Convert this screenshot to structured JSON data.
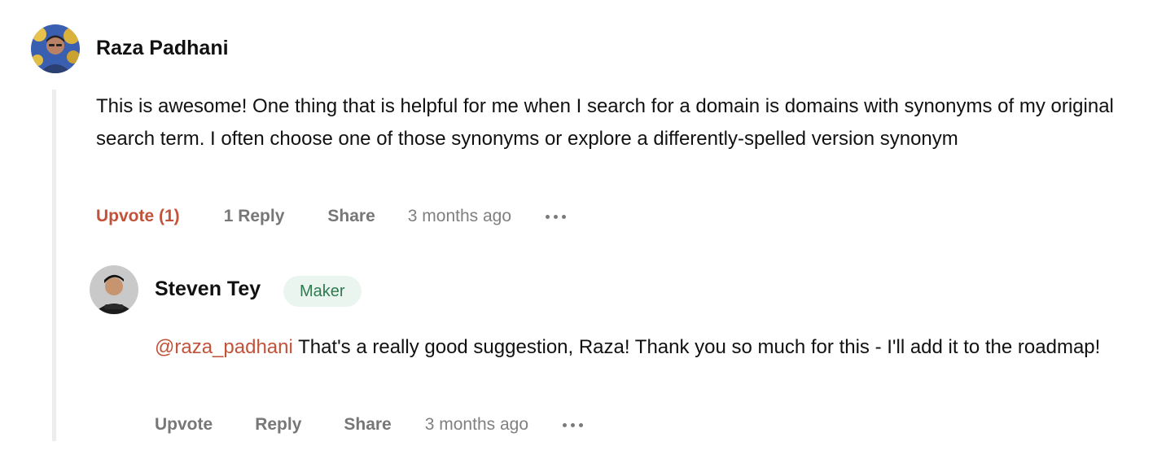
{
  "comment": {
    "author": "Raza Padhani",
    "body": "This is awesome! One thing that is helpful for me when I search for a domain is domains with synonyms of my original search term. I often choose one of those synonyms or explore a differently-spelled version synonym",
    "actions": {
      "upvote": "Upvote (1)",
      "reply": "1 Reply",
      "share": "Share",
      "time": "3 months ago"
    },
    "upvoted": true
  },
  "reply": {
    "author": "Steven Tey",
    "badge": "Maker",
    "mention": "@raza_padhani",
    "body": " That's a really good suggestion, Raza! Thank you so much for this - I'll add it to the roadmap!",
    "actions": {
      "upvote": "Upvote",
      "reply": "Reply",
      "share": "Share",
      "time": "3 months ago"
    }
  },
  "icons": {
    "more": "more-dots-icon"
  },
  "colors": {
    "accent": "#c2533a",
    "maker_badge_bg": "#e9f5ee",
    "maker_badge_text": "#2f7a4f",
    "muted": "#777777"
  }
}
